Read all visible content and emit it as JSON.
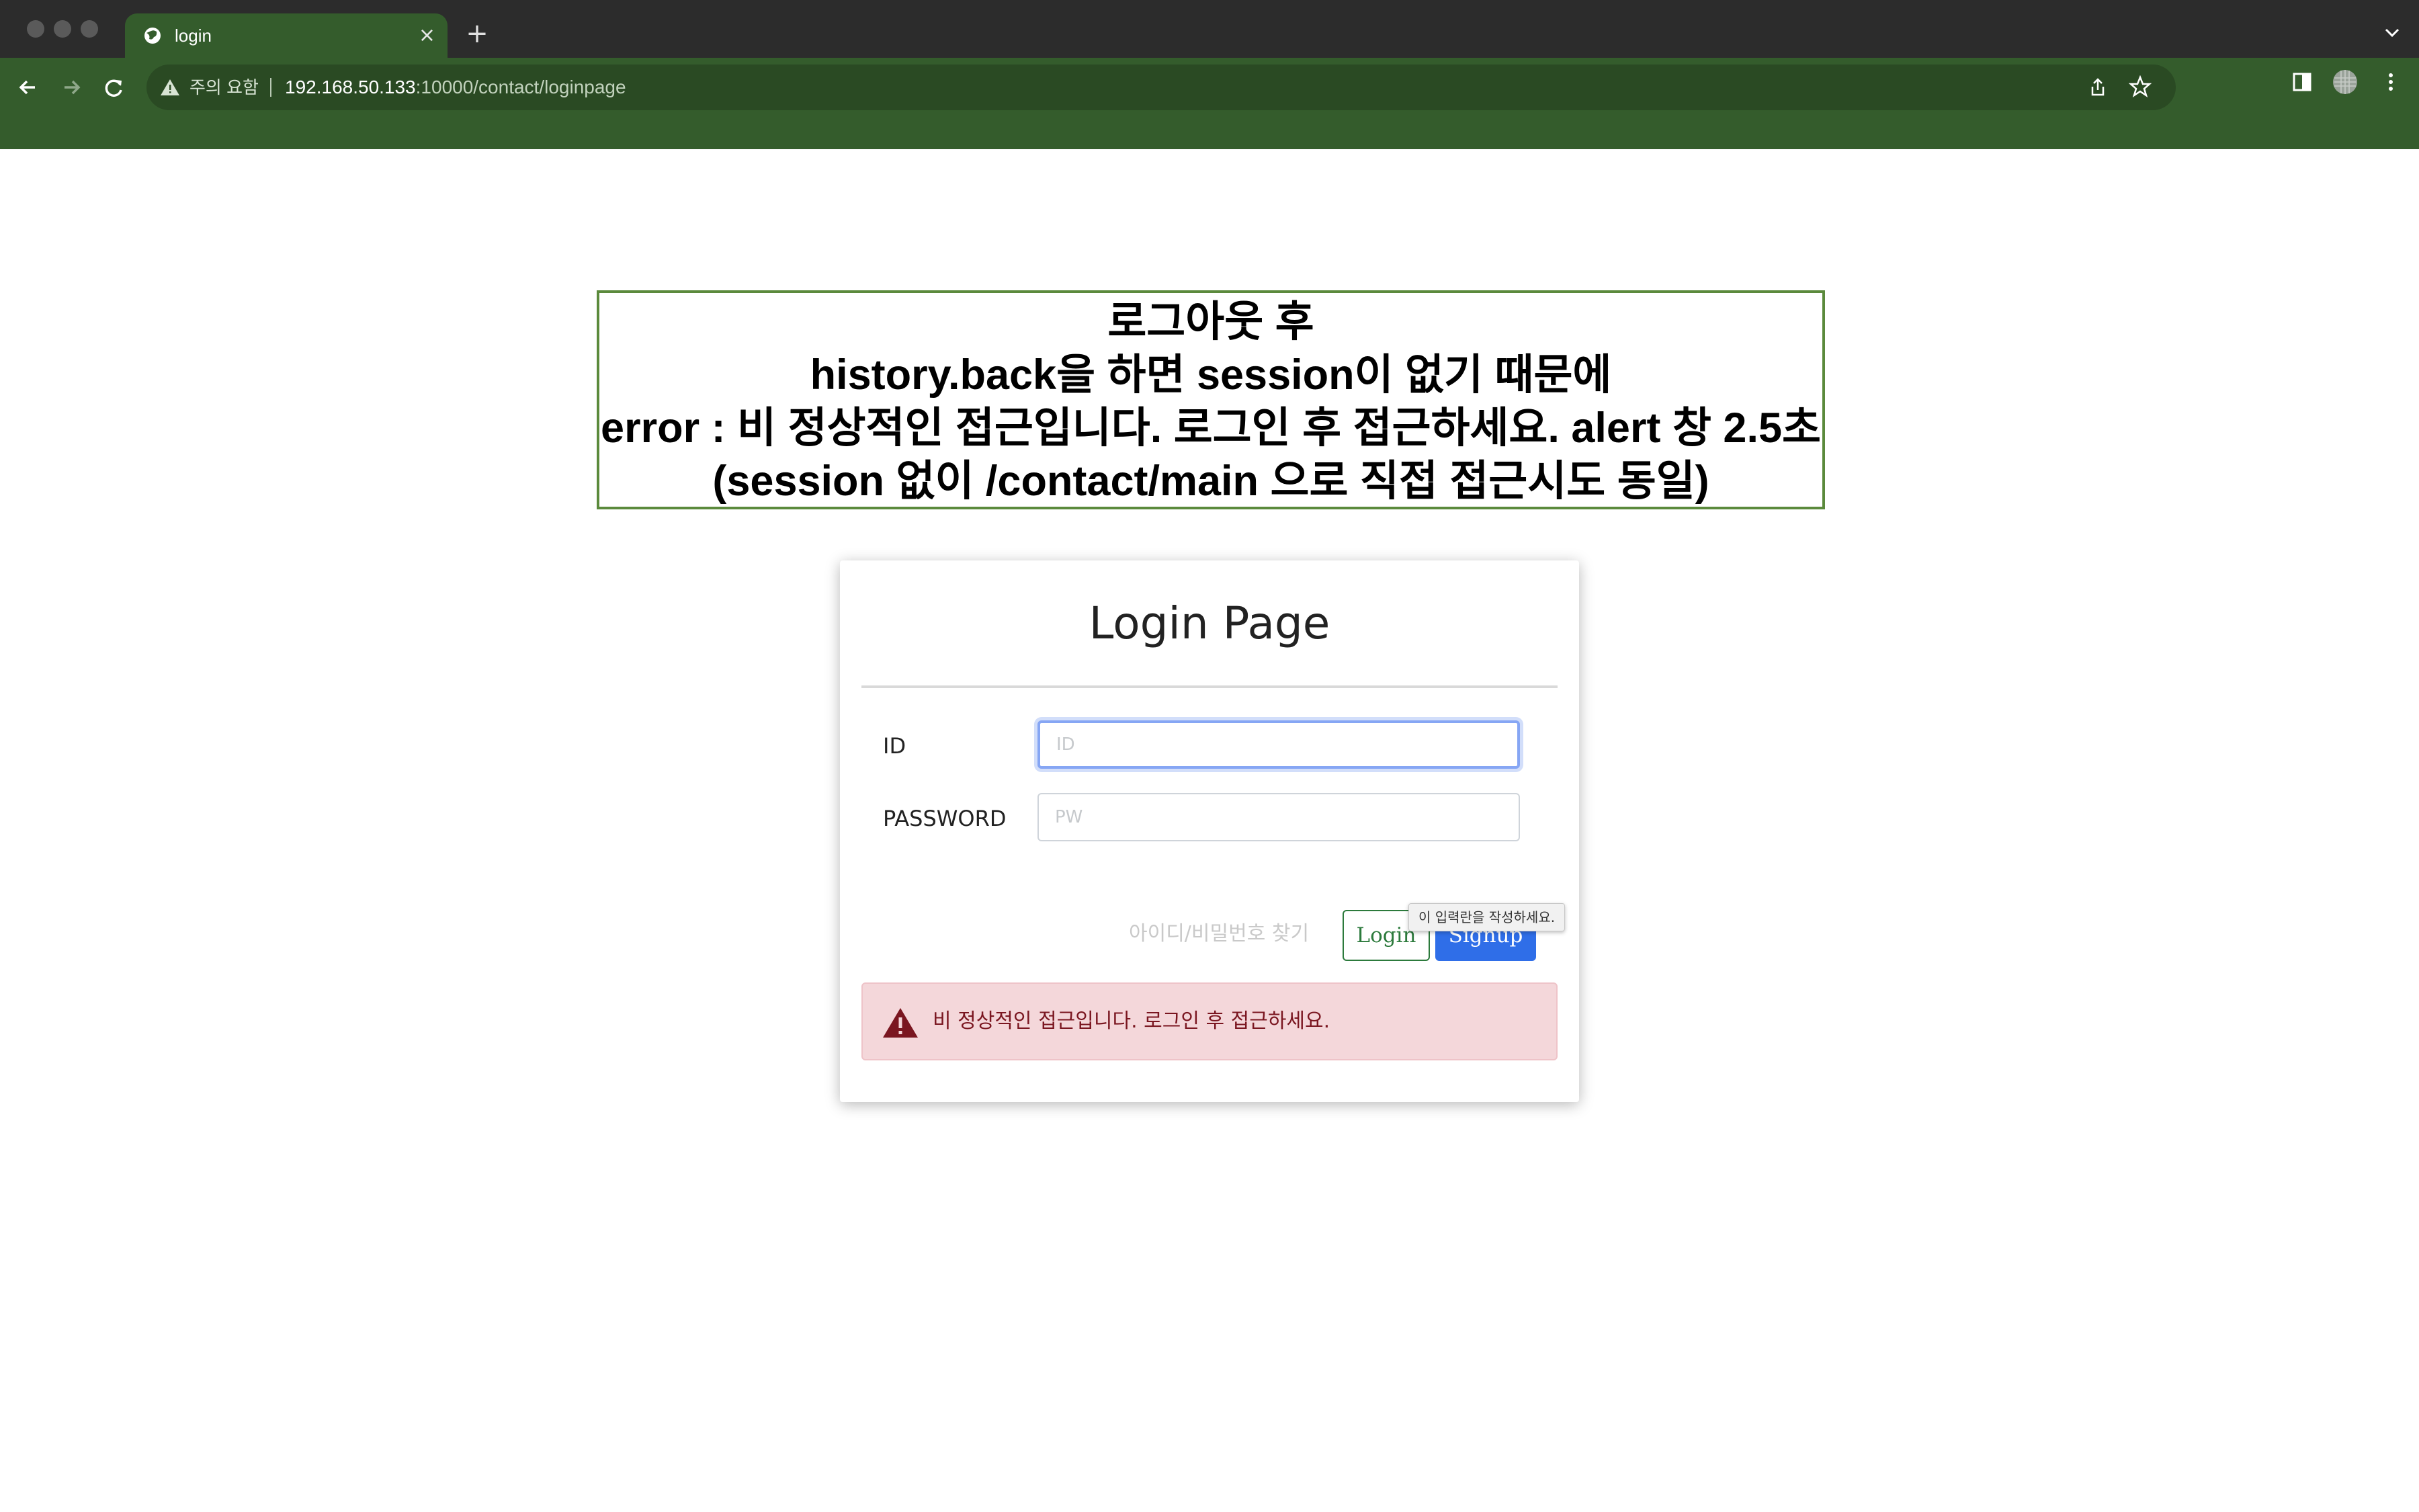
{
  "browser": {
    "tab_title": "login",
    "tab_close": "×",
    "new_tab": "+",
    "security_warning": "주의 요함",
    "url_host": "192.168.50.133",
    "url_path": ":10000/contact/loginpage"
  },
  "note": {
    "lines": [
      "로그아웃 후",
      "history.back을 하면 session이 없기 때문에",
      "error : 비 정상적인 접근입니다. 로그인 후 접근하세요. alert 창 2.5초",
      "(session 없이 /contact/main 으로 직접 접근시도 동일)"
    ]
  },
  "login": {
    "heading": "Login Page",
    "id_label": "ID",
    "id_placeholder": "ID",
    "pw_label": "PASSWORD",
    "pw_placeholder": "PW",
    "find_link": "아이디/비밀번호 찾기",
    "login_button": "Login",
    "signup_button": "Signup",
    "tooltip": "이 입력란을 작성하세요.",
    "alert_message": "비 정상적인 접근입니다. 로그인 후 접근하세요."
  },
  "colors": {
    "theme_green": "#345c2c",
    "alert_bg": "#f4d7da",
    "signup_blue": "#2f6ee8"
  }
}
